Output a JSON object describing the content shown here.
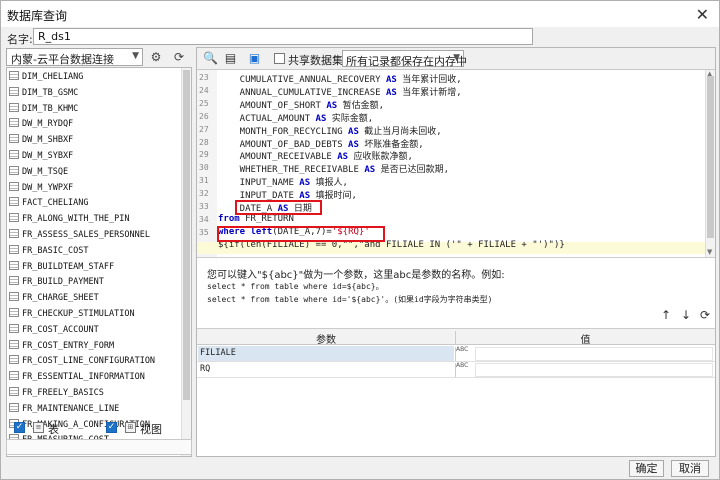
{
  "window": {
    "title": "数据库查询",
    "close": "✕"
  },
  "name": {
    "label": "名字:",
    "value": "R_ds1"
  },
  "left": {
    "connection": "内蒙-云平台数据连接",
    "tables": [
      "DIM_CHELIANG",
      "DIM_TB_GSMC",
      "DIM_TB_KHMC",
      "DW_M_RYDQF",
      "DW_M_SHBXF",
      "DW_M_SYBXF",
      "DW_M_TSQE",
      "DW_M_YWPXF",
      "FACT_CHELIANG",
      "FR_ALONG_WITH_THE_PIN",
      "FR_ASSESS_SALES_PERSONNEL",
      "FR_BASIC_COST",
      "FR_BUILDTEAM_STAFF",
      "FR_BUILD_PAYMENT",
      "FR_CHARGE_SHEET",
      "FR_CHECKUP_STIMULATION",
      "FR_COST_ACCOUNT",
      "FR_COST_ENTRY_FORM",
      "FR_COST_LINE_CONFIGURATION",
      "FR_ESSENTIAL_INFORMATION",
      "FR_FREELY_BASICS",
      "FR_MAINTENANCE_LINE",
      "FR_MAKING_A_CONFIGURATION",
      "FR_MEASURING_COST"
    ],
    "check_table": "表",
    "check_view": "视图"
  },
  "toolbar": {
    "share_label": "共享数据集",
    "mode": "所有记录都保存在内存中"
  },
  "editor": {
    "lines": [
      {
        "n": "23",
        "parts": [
          [
            "",
            "    CUMULATIVE_ANNUAL_RECOVERY "
          ],
          [
            "kw",
            "AS"
          ],
          [
            "",
            " 当年累计回收,"
          ]
        ]
      },
      {
        "n": "24",
        "parts": [
          [
            "",
            "    ANNUAL_CUMULATIVE_INCREASE "
          ],
          [
            "kw",
            "AS"
          ],
          [
            "",
            " 当年累计新增,"
          ]
        ]
      },
      {
        "n": "25",
        "parts": [
          [
            "",
            "    AMOUNT_OF_SHORT "
          ],
          [
            "kw",
            "AS"
          ],
          [
            "",
            " 暂估金额,"
          ]
        ]
      },
      {
        "n": "26",
        "parts": [
          [
            "",
            "    ACTUAL_AMOUNT "
          ],
          [
            "kw",
            "AS"
          ],
          [
            "",
            " 实际金额,"
          ]
        ]
      },
      {
        "n": "27",
        "parts": [
          [
            "",
            "    MONTH_FOR_RECYCLING "
          ],
          [
            "kw",
            "AS"
          ],
          [
            "",
            " 截止当月尚未回收,"
          ]
        ]
      },
      {
        "n": "28",
        "parts": [
          [
            "",
            "    AMOUNT_OF_BAD_DEBTS "
          ],
          [
            "kw",
            "AS"
          ],
          [
            "",
            " 坏账准备金额,"
          ]
        ]
      },
      {
        "n": "29",
        "parts": [
          [
            "",
            "    AMOUNT_RECEIVABLE "
          ],
          [
            "kw",
            "AS"
          ],
          [
            "",
            " 应收账款净额,"
          ]
        ]
      },
      {
        "n": "30",
        "parts": [
          [
            "",
            "    WHETHER_THE_RECEIVABLE "
          ],
          [
            "kw",
            "AS"
          ],
          [
            "",
            " 是否已达回款期,"
          ]
        ]
      },
      {
        "n": "31",
        "parts": [
          [
            "",
            "    INPUT_NAME "
          ],
          [
            "kw",
            "AS"
          ],
          [
            "",
            " 填报人,"
          ]
        ]
      },
      {
        "n": "32",
        "parts": [
          [
            "",
            "    INPUT_DATE "
          ],
          [
            "kw",
            "AS"
          ],
          [
            "",
            " 填报时间,"
          ]
        ]
      },
      {
        "n": "33",
        "parts": [
          [
            "",
            "    DATE_A "
          ],
          [
            "kw",
            "AS"
          ],
          [
            "",
            " 日期"
          ]
        ]
      },
      {
        "n": "34",
        "parts": [
          [
            "kw",
            "from"
          ],
          [
            "",
            " FR_RETURN"
          ]
        ]
      },
      {
        "n": "35",
        "parts": [
          [
            "kw",
            "where"
          ],
          [
            "",
            " "
          ],
          [
            "kw",
            "left"
          ],
          [
            "",
            "(DATE_A,7)="
          ],
          [
            "str",
            "'${RQ}'"
          ]
        ]
      },
      {
        "n": "36",
        "parts": [
          [
            "",
            "${if(len(FILIALE) == 0,\"\",\"and FILIALE IN ('\" + FILIALE + \"')\")}"
          ]
        ]
      }
    ]
  },
  "help": {
    "line1": "您可以键入\"${abc}\"做为一个参数，这里abc是参数的名称。例如:",
    "line2": "select * from table where id=${abc}。",
    "line3": "select * from table where id='${abc}'。(如果id字段为字符串类型)"
  },
  "params": {
    "col_name": "参数",
    "col_value": "值",
    "type_label": "ABC",
    "rows": [
      {
        "name": "FILIALE",
        "value": ""
      },
      {
        "name": "RQ",
        "value": ""
      }
    ]
  },
  "footer": {
    "ok": "确定",
    "cancel": "取消"
  }
}
